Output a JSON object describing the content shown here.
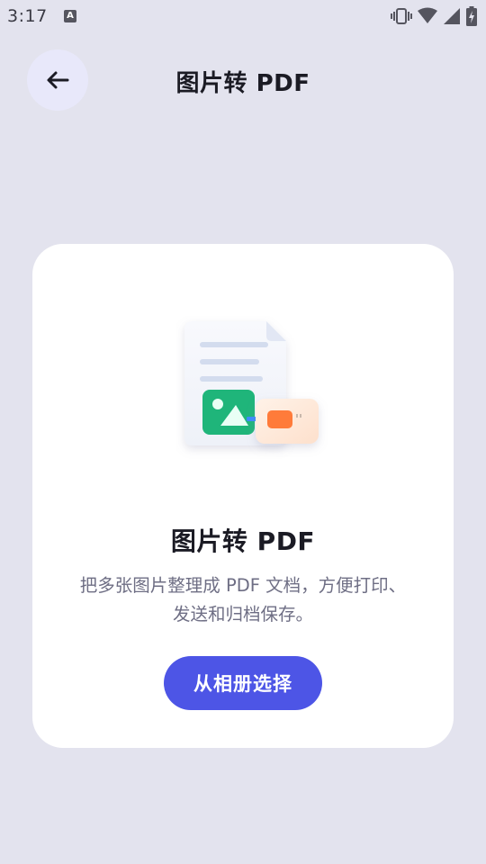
{
  "status_bar": {
    "time": "3:17",
    "notification_icon": "a-notification-icon",
    "icons": [
      "vibrate-icon",
      "wifi-icon",
      "signal-icon",
      "battery-charging-icon"
    ]
  },
  "app_bar": {
    "back_icon": "arrow-left-icon",
    "title": "图片转 PDF"
  },
  "card": {
    "illustration": "image-to-pdf-illustration",
    "title": "图片转 PDF",
    "description_line1": "把多张图片整理成 PDF 文档，方便打印、",
    "description_line2": "发送和归档保存。",
    "button_label": "从相册选择"
  },
  "colors": {
    "background": "#e3e3ee",
    "card": "#ffffff",
    "accent": "#4d55e6",
    "back_button_bg": "#e8e8fa",
    "image_green": "#1fb57a",
    "pdf_orange": "#ff7b3a"
  }
}
